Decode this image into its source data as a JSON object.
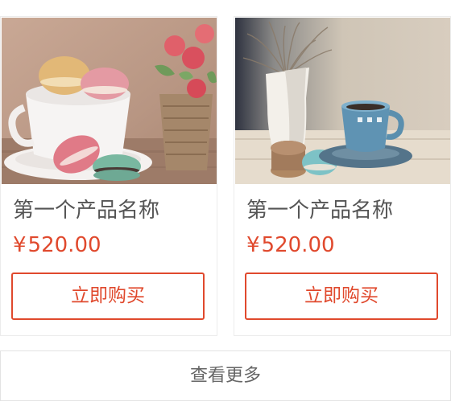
{
  "currency_symbol": "¥",
  "products": [
    {
      "name": "第一个产品名称",
      "price": "520.00",
      "button_label": "立即购买",
      "image_subject": "macarons-teacup-flowers-photo"
    },
    {
      "name": "第一个产品名称",
      "price": "520.00",
      "button_label": "立即购买",
      "image_subject": "macarons-blue-cup-vase-photo"
    }
  ],
  "more_button_label": "查看更多",
  "colors": {
    "accent": "#e0492d",
    "text": "#555555",
    "border": "#ececec"
  }
}
